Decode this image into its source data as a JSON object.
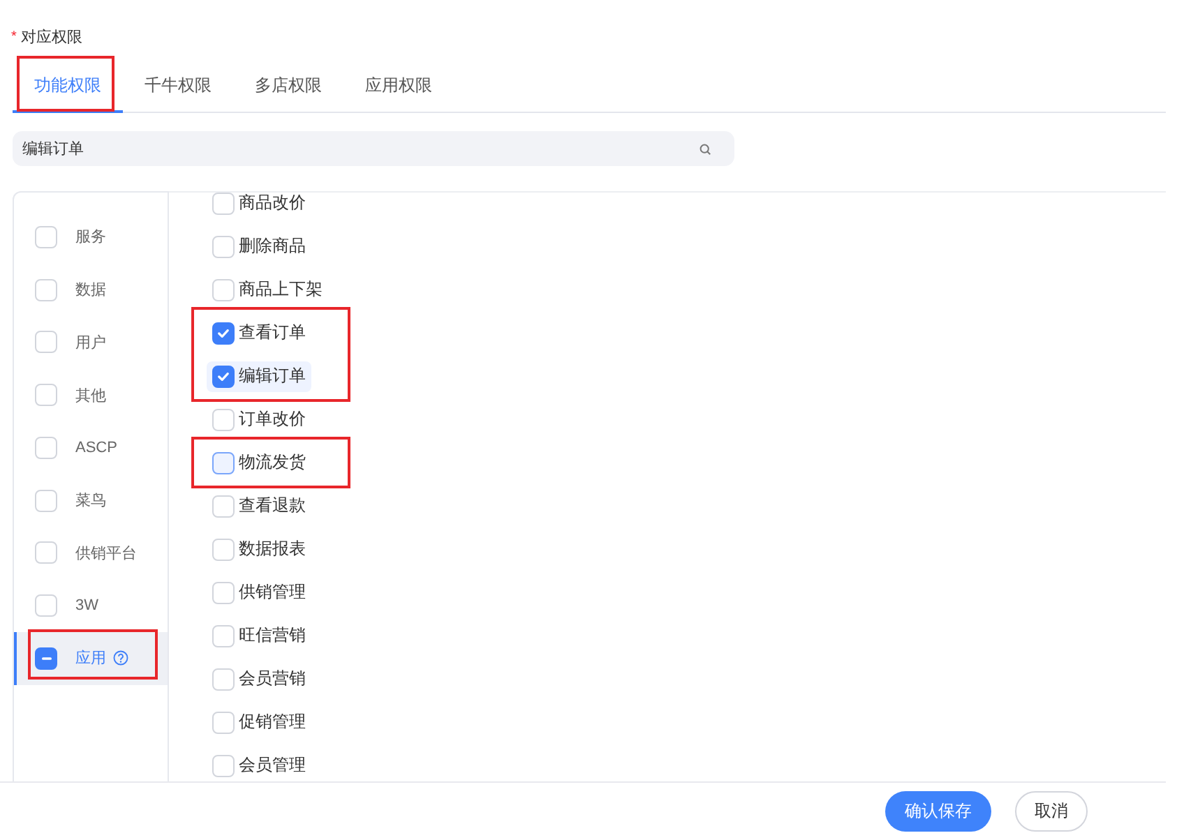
{
  "field_label": {
    "mark": "*",
    "text": "对应权限"
  },
  "tabs": [
    {
      "label": "功能权限",
      "selected": true,
      "highlighted": true
    },
    {
      "label": "千牛权限",
      "selected": false,
      "highlighted": false
    },
    {
      "label": "多店权限",
      "selected": false,
      "highlighted": false
    },
    {
      "label": "应用权限",
      "selected": false,
      "highlighted": false
    }
  ],
  "search": {
    "value": "编辑订单"
  },
  "categories": [
    {
      "label": "服务",
      "checked": false,
      "indeterminate": false,
      "selected": false,
      "help": false,
      "highlighted": false
    },
    {
      "label": "数据",
      "checked": false,
      "indeterminate": false,
      "selected": false,
      "help": false,
      "highlighted": false
    },
    {
      "label": "用户",
      "checked": false,
      "indeterminate": false,
      "selected": false,
      "help": false,
      "highlighted": false
    },
    {
      "label": "其他",
      "checked": false,
      "indeterminate": false,
      "selected": false,
      "help": false,
      "highlighted": false
    },
    {
      "label": "ASCP",
      "checked": false,
      "indeterminate": false,
      "selected": false,
      "help": false,
      "highlighted": false
    },
    {
      "label": "菜鸟",
      "checked": false,
      "indeterminate": false,
      "selected": false,
      "help": false,
      "highlighted": false
    },
    {
      "label": "供销平台",
      "checked": false,
      "indeterminate": false,
      "selected": false,
      "help": false,
      "highlighted": false
    },
    {
      "label": "3W",
      "checked": false,
      "indeterminate": false,
      "selected": false,
      "help": false,
      "highlighted": false
    },
    {
      "label": "应用",
      "checked": false,
      "indeterminate": true,
      "selected": true,
      "help": true,
      "highlighted": true
    }
  ],
  "permission_groups": [
    {
      "highlighted": false,
      "items": [
        {
          "label": "商品改价",
          "checked": false,
          "hovered": false,
          "focused": false
        },
        {
          "label": "删除商品",
          "checked": false,
          "hovered": false,
          "focused": false
        },
        {
          "label": "商品上下架",
          "checked": false,
          "hovered": false,
          "focused": false
        }
      ]
    },
    {
      "highlighted": true,
      "items": [
        {
          "label": "查看订单",
          "checked": true,
          "hovered": false,
          "focused": false
        },
        {
          "label": "编辑订单",
          "checked": true,
          "hovered": true,
          "focused": false
        }
      ]
    },
    {
      "highlighted": false,
      "items": [
        {
          "label": "订单改价",
          "checked": false,
          "hovered": false,
          "focused": false
        }
      ]
    },
    {
      "highlighted": true,
      "items": [
        {
          "label": "物流发货",
          "checked": false,
          "hovered": false,
          "focused": true
        }
      ]
    },
    {
      "highlighted": false,
      "items": [
        {
          "label": "查看退款",
          "checked": false,
          "hovered": false,
          "focused": false
        },
        {
          "label": "数据报表",
          "checked": false,
          "hovered": false,
          "focused": false
        },
        {
          "label": "供销管理",
          "checked": false,
          "hovered": false,
          "focused": false
        },
        {
          "label": "旺信营销",
          "checked": false,
          "hovered": false,
          "focused": false
        },
        {
          "label": "会员营销",
          "checked": false,
          "hovered": false,
          "focused": false
        },
        {
          "label": "促销管理",
          "checked": false,
          "hovered": false,
          "focused": false
        },
        {
          "label": "会员管理",
          "checked": false,
          "hovered": false,
          "focused": false
        }
      ]
    }
  ],
  "buttons": [
    {
      "label": "确认保存",
      "kind": "primary"
    },
    {
      "label": "取消",
      "kind": "default"
    }
  ]
}
